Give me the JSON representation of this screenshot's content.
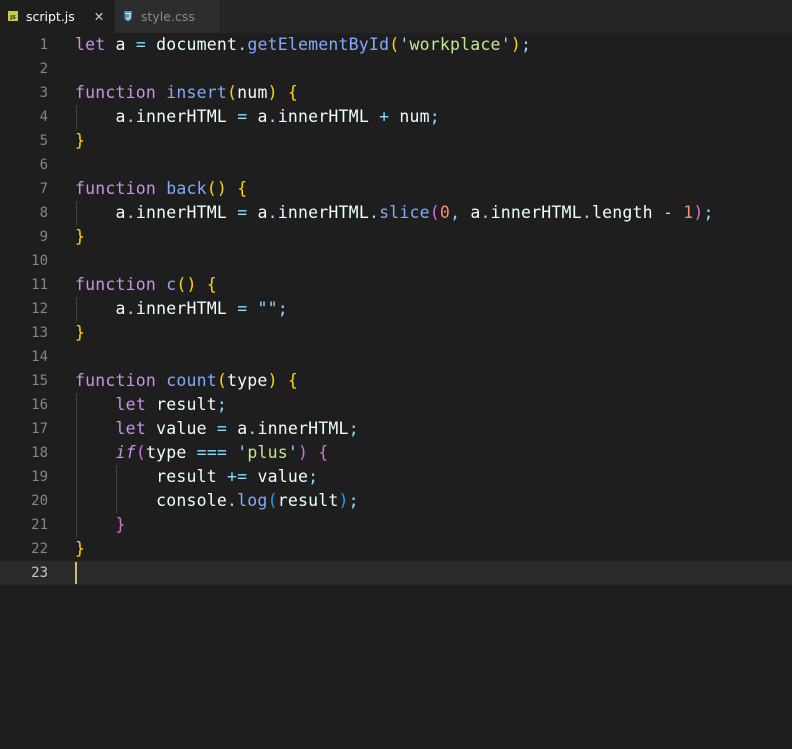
{
  "tabs": [
    {
      "label": "script.js",
      "icon": "js-file-icon",
      "active": true,
      "close": "✕"
    },
    {
      "label": "style.css",
      "icon": "css-file-icon",
      "active": false
    }
  ],
  "editor": {
    "current_line": 23,
    "line_numbers": [
      "1",
      "2",
      "3",
      "4",
      "5",
      "6",
      "7",
      "8",
      "9",
      "10",
      "11",
      "12",
      "13",
      "14",
      "15",
      "16",
      "17",
      "18",
      "19",
      "20",
      "21",
      "22",
      "23"
    ],
    "lines": [
      "let a = document.getElementById('workplace');",
      "",
      "function insert(num) {",
      "    a.innerHTML = a.innerHTML + num;",
      "}",
      "",
      "function back() {",
      "    a.innerHTML = a.innerHTML.slice(0, a.innerHTML.length - 1);",
      "}",
      "",
      "function c() {",
      "    a.innerHTML = \"\";",
      "}",
      "",
      "function count(type) {",
      "    let result;",
      "    let value = a.innerHTML;",
      "    if(type === 'plus') {",
      "        result += value;",
      "        console.log(result);",
      "    }",
      "}",
      ""
    ]
  },
  "colors": {
    "background": "#1e1e1e",
    "tabbar": "#252526",
    "keyword": "#c792ea",
    "function": "#82aaff",
    "string": "#c3e88d",
    "number": "#f78c6c",
    "operator": "#89ddff",
    "cursor": "#d7ba7d"
  }
}
